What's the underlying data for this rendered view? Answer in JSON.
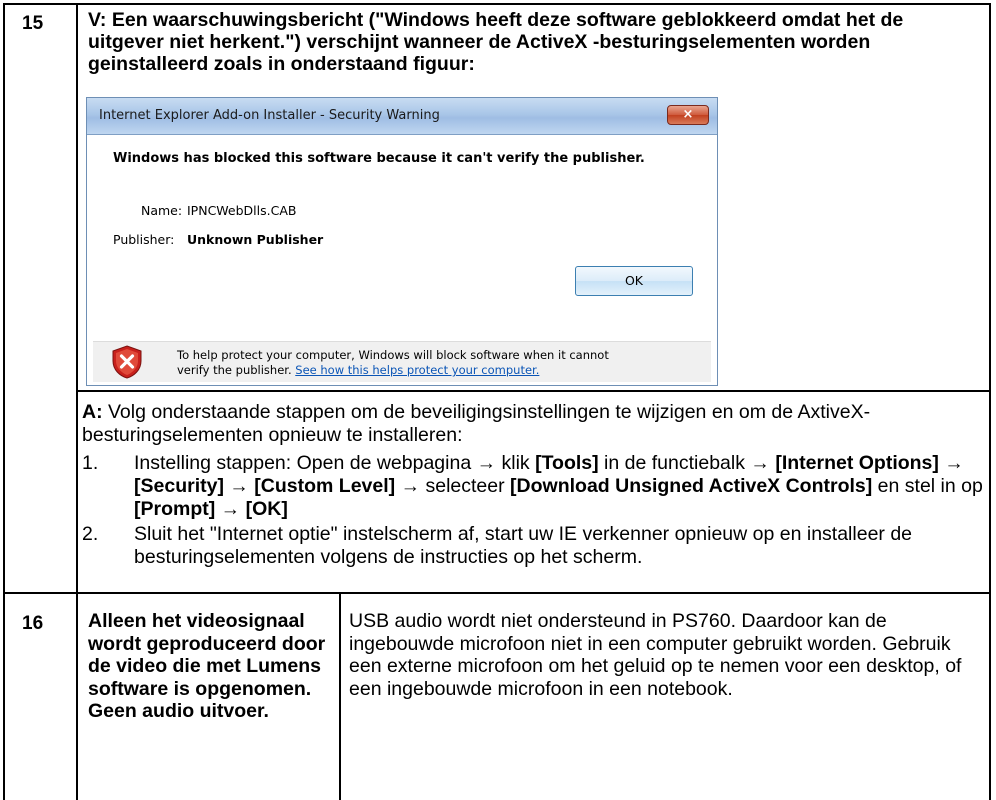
{
  "row15": {
    "number": "15",
    "question": "V: Een waarschuwingsbericht (\"Windows heeft deze software geblokkeerd omdat het de uitgever niet herkent.\") verschijnt wanneer de ActiveX -besturingselementen worden geinstalleerd zoals in onderstaand figuur:",
    "dialog": {
      "title": "Internet Explorer Add-on Installer - Security Warning",
      "close_glyph": "×",
      "heading": "Windows has blocked this software because it can't verify the publisher.",
      "name_label": "Name:",
      "name_value": "IPNCWebDlls.CAB",
      "publisher_label": "Publisher:",
      "publisher_value": "Unknown Publisher",
      "ok_label": "OK",
      "footer_text_1": "To help protect your computer, Windows will block software when it cannot",
      "footer_text_2": "verify the publisher.",
      "footer_link": "See how this helps protect your computer."
    },
    "answer_prefix": "A:",
    "answer_text": " Volg onderstaande stappen om de beveiligingsinstellingen te wijzigen en om de AxtiveX-besturingselementen opnieuw te installeren:",
    "steps": [
      {
        "n": "1.",
        "t1": "Instelling stappen: Open de webpagina → klik ",
        "b1": "[Tools]",
        "t2": " in de functiebalk → ",
        "b2": "[Internet Options]",
        "t3": " → ",
        "b3": "[Security]",
        "t4": " → ",
        "b4": "[Custom Level]",
        "t5": " → selecteer ",
        "b5": "[Download Unsigned ActiveX Controls]",
        "t6": " en stel in op ",
        "b6": "[Prompt]",
        "t7": " → ",
        "b7": "[OK]"
      },
      {
        "n": "2.",
        "t": "Sluit het \"Internet optie\" instelscherm af, start uw IE verkenner opnieuw op en installeer de besturingselementen volgens de instructies op het scherm."
      }
    ]
  },
  "row16": {
    "number": "16",
    "problem": "Alleen het videosignaal wordt geproduceerd door de video die met Lumens software is opgenomen. Geen audio uitvoer.",
    "solution": "USB audio wordt niet ondersteund in PS760. Daardoor kan de ingebouwde microfoon niet in een computer gebruikt worden. Gebruik een externe microfoon om het geluid op te nemen voor een desktop, of een ingebouwde microfoon in een notebook."
  },
  "colors": {
    "border": "#000000",
    "link": "#0b55b6",
    "dialog_title_bar": "#a9c6e8",
    "close_button": "#cf5a3c",
    "shield_red": "#c8201c"
  },
  "icons": [
    "shield-warning-icon",
    "close-icon"
  ]
}
